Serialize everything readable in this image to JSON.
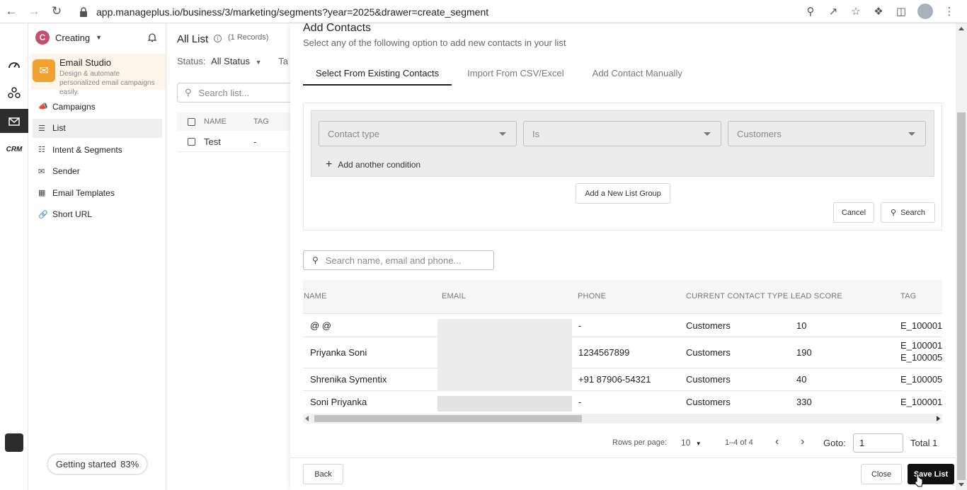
{
  "browser": {
    "url": "app.manageplus.io/business/3/marketing/segments?year=2025&drawer=create_segment"
  },
  "workspace": {
    "logo_letter": "C",
    "name": "Creating"
  },
  "rail": {
    "crm_label": "CRM"
  },
  "studio": {
    "title": "Email Studio",
    "subtitle": "Design & automate personalized email campaigns easily."
  },
  "sidebar": {
    "items": [
      {
        "label": "Campaigns"
      },
      {
        "label": "List"
      },
      {
        "label": "Intent & Segments"
      },
      {
        "label": "Sender"
      },
      {
        "label": "Email Templates"
      },
      {
        "label": "Short URL"
      }
    ]
  },
  "getting_started": {
    "label": "Getting started",
    "percent": "83%"
  },
  "list_page": {
    "title": "All List",
    "records": "(1 Records)",
    "status_label": "Status:",
    "status_value": "All Status",
    "tag_trunc": "Ta",
    "search_placeholder": "Search list...",
    "columns": [
      "NAME",
      "TAG"
    ],
    "rows": [
      {
        "name": "Test",
        "tag": "-"
      }
    ]
  },
  "drawer": {
    "title": "Add Contacts",
    "subtitle": "Select any of the following option to add new contacts in your list",
    "tabs": [
      {
        "label": "Select From Existing Contacts"
      },
      {
        "label": "Import From CSV/Excel"
      },
      {
        "label": "Add Contact Manually"
      }
    ],
    "conditions": {
      "field_placeholder": "Contact type",
      "operator_placeholder": "Is",
      "value_placeholder": "Customers",
      "add_condition": "Add another condition"
    },
    "add_group_button": "Add a New List Group",
    "cancel_button": "Cancel",
    "search_button": "Search",
    "contact_search_placeholder": "Search name, email and phone...",
    "table": {
      "columns": [
        "NAME",
        "EMAIL",
        "PHONE",
        "CURRENT CONTACT TYPE",
        "LEAD SCORE",
        "TAG"
      ],
      "rows": [
        {
          "name": "@ @",
          "phone": "-",
          "type": "Customers",
          "score": "10",
          "tag": "E_100001",
          "tag2": ""
        },
        {
          "name": "Priyanka Soni",
          "phone": "1234567899",
          "type": "Customers",
          "score": "190",
          "tag": "E_100001,",
          "tag2": "E_100005"
        },
        {
          "name": "Shrenika Symentix",
          "phone": "+91 87906-54321",
          "type": "Customers",
          "score": "40",
          "tag": "E_100005",
          "tag2": ""
        },
        {
          "name": "Soni Priyanka",
          "phone": "-",
          "type": "Customers",
          "score": "330",
          "tag": "E_100001,",
          "tag2": ""
        }
      ]
    },
    "pagination": {
      "rows_per_page_label": "Rows per page:",
      "rows_per_page_value": "10",
      "range": "1–4 of 4",
      "goto_label": "Goto:",
      "goto_value": "1",
      "total": "Total 1"
    },
    "footer": {
      "back_button": "Back",
      "close_button": "Close",
      "save_button": "Save List"
    }
  },
  "colors": {
    "workspace_logo": "#c64f6e",
    "studio_icon": "#f0a12f",
    "studio_bg": "#fdf5e9",
    "primary_button": "#111111"
  }
}
